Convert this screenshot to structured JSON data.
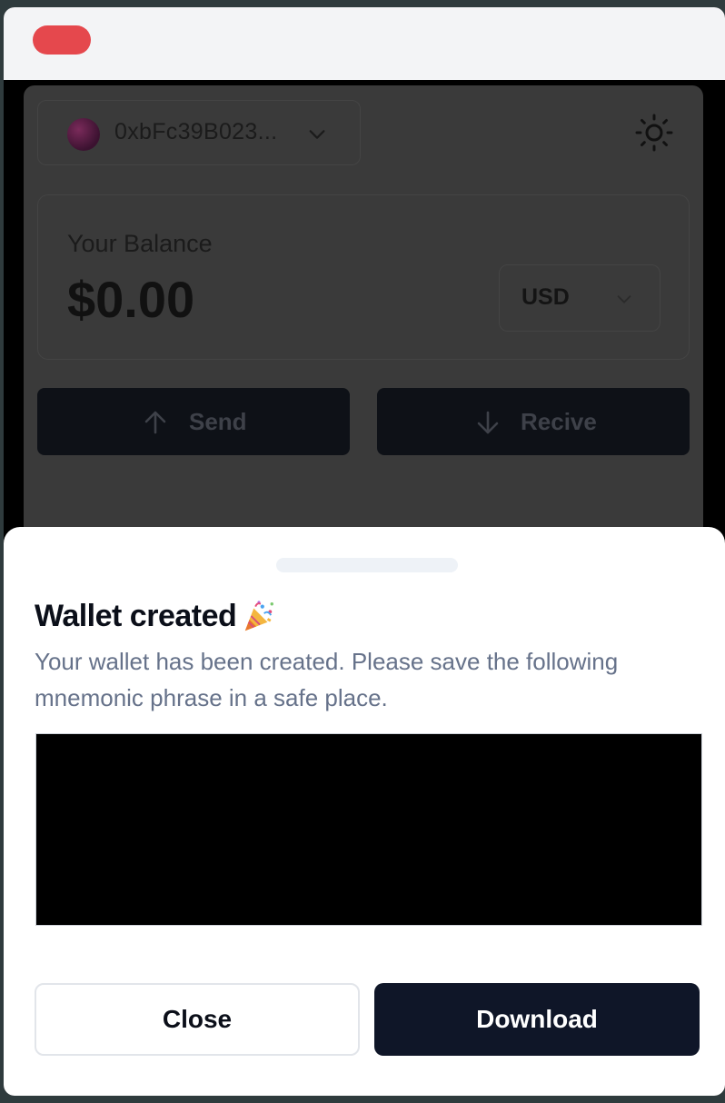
{
  "window": {
    "close_color": "#e5484d"
  },
  "header": {
    "account_label": "0xbFc39B023...",
    "avatar_icon": "avatar",
    "theme_icon": "sun-icon"
  },
  "balance": {
    "title": "Your Balance",
    "value": "$0.00",
    "currency": "USD"
  },
  "actions": {
    "send_label": "Send",
    "receive_label": "Recive"
  },
  "sheet": {
    "title": "Wallet created",
    "title_icon": "party-popper-icon",
    "description": "Your wallet has been created. Please save the following mnemonic phrase in a safe place.",
    "close_label": "Close",
    "download_label": "Download"
  },
  "colors": {
    "primary_button": "#0f1628",
    "description_text": "#66728a"
  }
}
